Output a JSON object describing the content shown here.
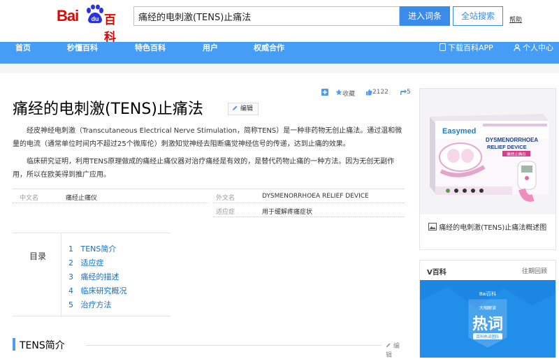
{
  "header": {
    "logo_text_bai": "Bai",
    "logo_text_du": "du",
    "logo_text_baike": "百科",
    "search_value": "痛经的电刺激(TENS)止痛法",
    "enter_button": "进入词条",
    "site_search_button": "全站搜索",
    "help_link": "帮助"
  },
  "nav": {
    "items": [
      "首页",
      "秒懂百科",
      "特色百科",
      "用户",
      "权威合作"
    ],
    "download_app": "下载百科APP",
    "personal_center": "个人中心"
  },
  "tools": {
    "collect": "收藏",
    "like_count": "2122",
    "share_count": "5"
  },
  "entry": {
    "title": "痛经的电刺激(TENS)止痛法",
    "edit_label": "编辑",
    "para1": "经皮神经电刺激（Transcutaneous Electrical Nerve Stimulation，简称TENS）是一种非药物无创止痛法。通过温和微量的电流（通常单位时间内不超过25个微库伦）刺激知觉神经去阻断痛觉神经信号的传递，达到止痛的效果。",
    "para2": "临床研究证明，利用TENS原理做成的痛经止痛仪器对治疗痛经是有效的，是替代药物止痛的一种方法。因为无创无副作用，所以在欧美得到推广应用。"
  },
  "basic_info": {
    "cn_name_label": "中文名",
    "cn_name_value": "痛经止痛仪",
    "foreign_name_label": "外文名",
    "foreign_name_value": "DYSMENORRHOEA RELIEF DEVICE",
    "indication_label": "适应症",
    "indication_value": "用于缓解疼痛症状"
  },
  "toc": {
    "label": "目录",
    "items": [
      {
        "num": "1",
        "text": "TENS简介"
      },
      {
        "num": "2",
        "text": "适应症"
      },
      {
        "num": "3",
        "text": "痛经的描述"
      },
      {
        "num": "4",
        "text": "临床研究概况"
      },
      {
        "num": "5",
        "text": "治疗方法"
      }
    ]
  },
  "section1": {
    "title": "TENS简介",
    "edit_label": "编辑"
  },
  "album": {
    "brand": "Easymed",
    "box_line1": "DYSMENORRHOEA",
    "box_line2": "RELIEF DEVICE",
    "box_cn": "痛经止痛仪",
    "caption": "痛经的电刺激(TENS)止痛法概述图"
  },
  "vbaike": {
    "title": "V百科",
    "more": "往期回顾",
    "poster_brand": "Bai百科",
    "poster_small": "大咖解读",
    "poster_big": "热词",
    "poster_tag": "百科热词团队"
  },
  "colors": {
    "accent": "#459df5",
    "link": "#136ec2",
    "brand_red": "#e10601"
  }
}
